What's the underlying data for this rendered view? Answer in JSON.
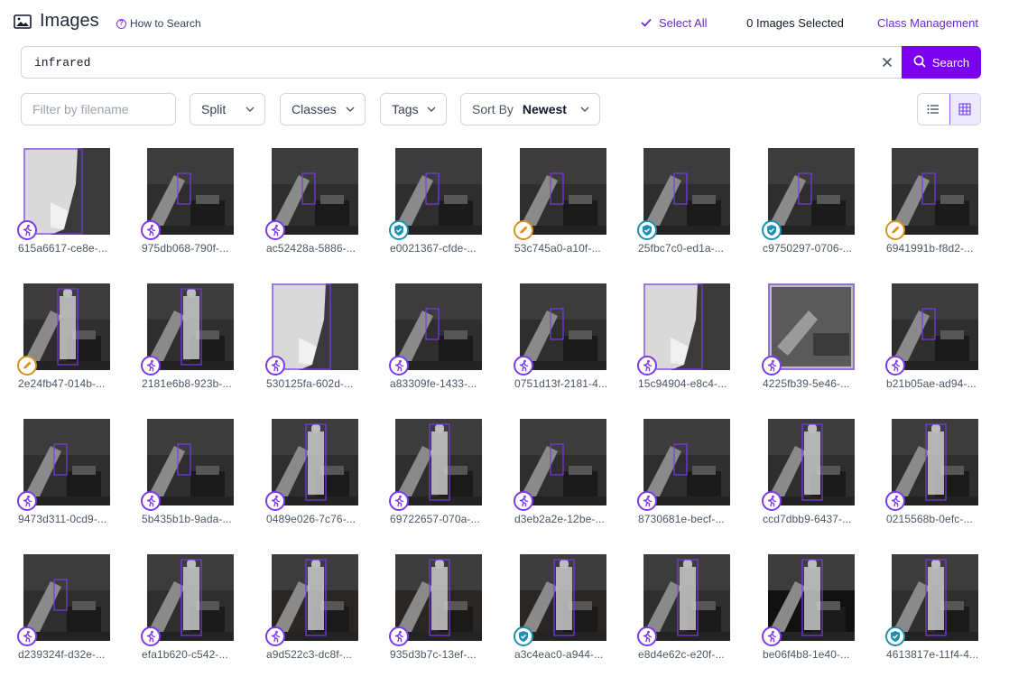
{
  "header": {
    "title": "Images",
    "how_to_search": "How to Search",
    "select_all": "Select All",
    "selected_count": "0 Images Selected",
    "class_management": "Class Management"
  },
  "search": {
    "value": "infrared",
    "button_label": "Search"
  },
  "filters": {
    "filename_placeholder": "Filter by filename",
    "split_label": "Split",
    "classes_label": "Classes",
    "tags_label": "Tags",
    "sort_label": "Sort By",
    "sort_value": "Newest"
  },
  "colors": {
    "accent": "#7c00f0",
    "annotated_badge": "#7c3aed",
    "approved_badge": "#1d8fb0",
    "pending_badge": "#d9901c"
  },
  "images": [
    {
      "filename": "615a6617-ce8e-...",
      "status": "annotated",
      "status_icon": "running-person-icon",
      "scene": "closeup"
    },
    {
      "filename": "975db068-790f-...",
      "status": "annotated",
      "status_icon": "running-person-icon",
      "scene": "room"
    },
    {
      "filename": "ac52428a-5886-...",
      "status": "annotated",
      "status_icon": "running-person-icon",
      "scene": "room"
    },
    {
      "filename": "e0021367-cfde-...",
      "status": "approved",
      "status_icon": "shield-check-icon",
      "scene": "room"
    },
    {
      "filename": "53c745a0-a10f-...",
      "status": "pending",
      "status_icon": "pencil-icon",
      "scene": "room"
    },
    {
      "filename": "25fbc7c0-ed1a-...",
      "status": "approved",
      "status_icon": "shield-check-icon",
      "scene": "room"
    },
    {
      "filename": "c9750297-0706-...",
      "status": "approved",
      "status_icon": "shield-check-icon",
      "scene": "room"
    },
    {
      "filename": "6941991b-f8d2-...",
      "status": "pending",
      "status_icon": "pencil-icon",
      "scene": "room"
    },
    {
      "filename": "2e24fb47-014b-...",
      "status": "pending",
      "status_icon": "pencil-icon",
      "scene": "person"
    },
    {
      "filename": "2181e6b8-923b-...",
      "status": "annotated",
      "status_icon": "running-person-icon",
      "scene": "person"
    },
    {
      "filename": "530125fa-602d-...",
      "status": "annotated",
      "status_icon": "running-person-icon",
      "scene": "closeup"
    },
    {
      "filename": "a83309fe-1433-...",
      "status": "annotated",
      "status_icon": "running-person-icon",
      "scene": "room"
    },
    {
      "filename": "0751d13f-2181-4...",
      "status": "annotated",
      "status_icon": "running-person-icon",
      "scene": "room"
    },
    {
      "filename": "15c94904-e8c4-...",
      "status": "annotated",
      "status_icon": "running-person-icon",
      "scene": "closeup"
    },
    {
      "filename": "4225fb39-5e46-...",
      "status": "annotated",
      "status_icon": "running-person-icon",
      "scene": "bright"
    },
    {
      "filename": "b21b05ae-ad94-...",
      "status": "annotated",
      "status_icon": "running-person-icon",
      "scene": "room"
    },
    {
      "filename": "9473d311-0cd9-...",
      "status": "annotated",
      "status_icon": "running-person-icon",
      "scene": "room"
    },
    {
      "filename": "5b435b1b-9ada-...",
      "status": "annotated",
      "status_icon": "running-person-icon",
      "scene": "room"
    },
    {
      "filename": "0489e026-7c76-...",
      "status": "annotated",
      "status_icon": "running-person-icon",
      "scene": "person"
    },
    {
      "filename": "69722657-070a-...",
      "status": "annotated",
      "status_icon": "running-person-icon",
      "scene": "person"
    },
    {
      "filename": "d3eb2a2e-12be-...",
      "status": "annotated",
      "status_icon": "running-person-icon",
      "scene": "room"
    },
    {
      "filename": "8730681e-becf-...",
      "status": "annotated",
      "status_icon": "running-person-icon",
      "scene": "room"
    },
    {
      "filename": "ccd7dbb9-6437-...",
      "status": "annotated",
      "status_icon": "running-person-icon",
      "scene": "person"
    },
    {
      "filename": "0215568b-0efc-...",
      "status": "annotated",
      "status_icon": "running-person-icon",
      "scene": "person"
    },
    {
      "filename": "d239324f-d32e-...",
      "status": "annotated",
      "status_icon": "running-person-icon",
      "scene": "room"
    },
    {
      "filename": "efa1b620-c542-...",
      "status": "annotated",
      "status_icon": "running-person-icon",
      "scene": "person"
    },
    {
      "filename": "a9d522c3-dc8f-...",
      "status": "annotated",
      "status_icon": "running-person-icon",
      "scene": "lit"
    },
    {
      "filename": "935d3b7c-13ef-...",
      "status": "annotated",
      "status_icon": "running-person-icon",
      "scene": "lit"
    },
    {
      "filename": "a3c4eac0-a944-...",
      "status": "approved",
      "status_icon": "shield-check-icon",
      "scene": "lit"
    },
    {
      "filename": "e8d4e62c-e20f-...",
      "status": "annotated",
      "status_icon": "running-person-icon",
      "scene": "person"
    },
    {
      "filename": "be06f4b8-1e40-...",
      "status": "annotated",
      "status_icon": "running-person-icon",
      "scene": "dark"
    },
    {
      "filename": "4613817e-11f4-4...",
      "status": "approved",
      "status_icon": "shield-check-icon",
      "scene": "person"
    }
  ]
}
